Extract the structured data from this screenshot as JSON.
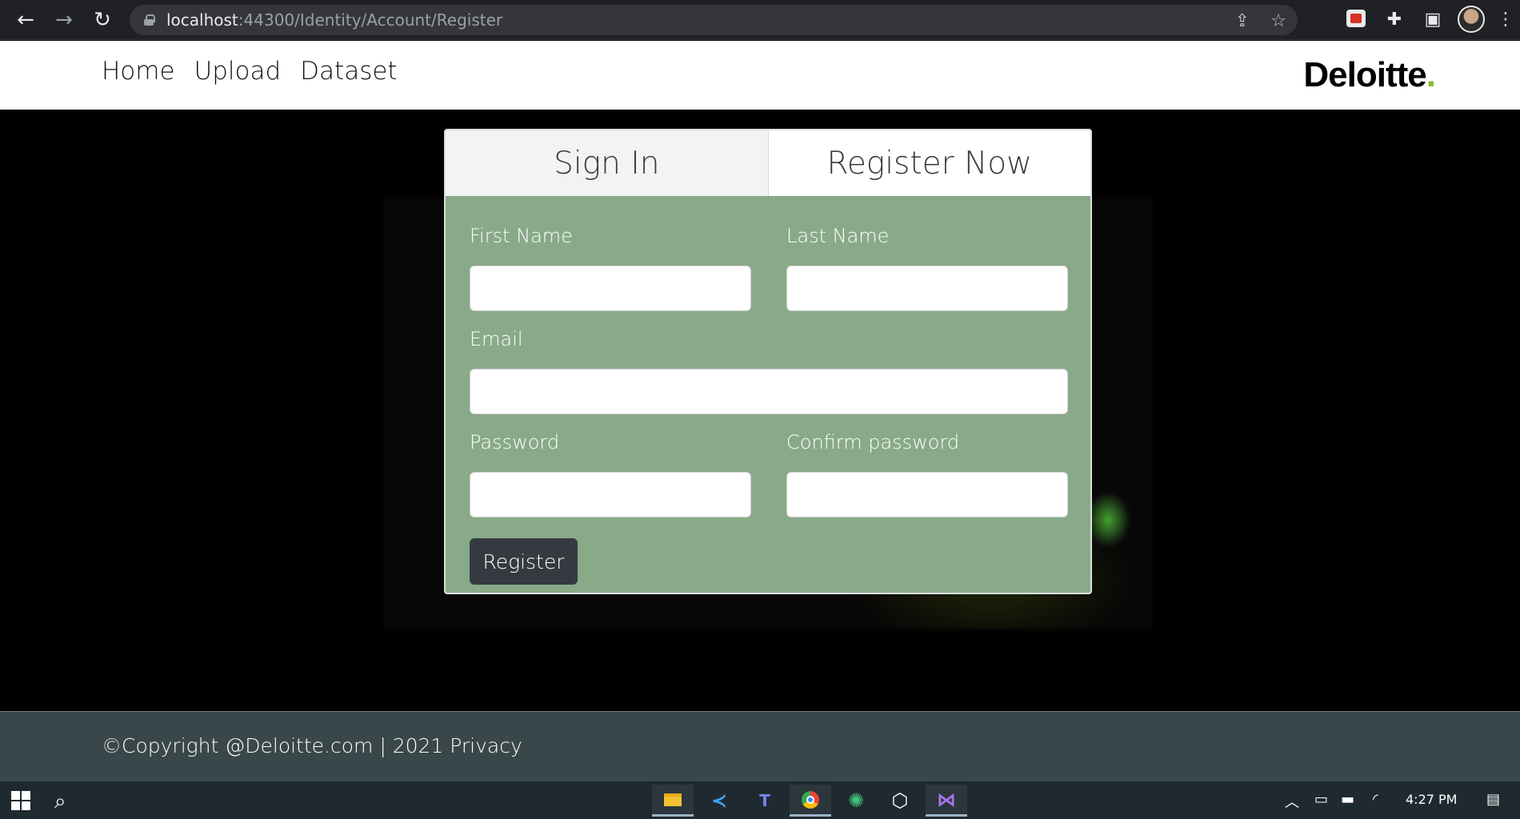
{
  "browser": {
    "url_host": "localhost",
    "url_rest": ":44300/Identity/Account/Register"
  },
  "site": {
    "nav": [
      "Home",
      "Upload",
      "Dataset"
    ],
    "brand": "Deloitte",
    "brand_dot": ".",
    "brand_dot_color": "#86bc25"
  },
  "auth": {
    "tabs": {
      "signin": "Sign In",
      "register": "Register Now"
    },
    "form": {
      "first_name_label": "First Name",
      "last_name_label": "Last Name",
      "email_label": "Email",
      "password_label": "Password",
      "confirm_password_label": "Confirm password",
      "submit_label": "Register"
    }
  },
  "footer": {
    "text": "©Copyright @Deloitte.com | 2021 Privacy"
  },
  "taskbar": {
    "clock": "4:27 PM",
    "apps": [
      "file-explorer-icon",
      "vscode-icon",
      "teams-icon",
      "chrome-icon",
      "spider-icon",
      "virtualbox-icon",
      "visual-studio-icon"
    ]
  },
  "colors": {
    "card_green": "#88aa88",
    "button_dark": "#343a40",
    "footer_bg": "#3a474a"
  }
}
